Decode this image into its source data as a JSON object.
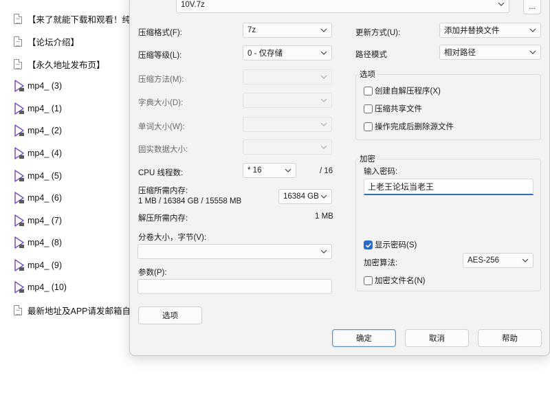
{
  "files": [
    {
      "type": "doc",
      "label": "【来了就能下载和观看！纯免"
    },
    {
      "type": "doc",
      "label": "【论坛介绍】"
    },
    {
      "type": "doc",
      "label": "【永久地址发布页】"
    },
    {
      "type": "video",
      "label": "mp4_ (3)"
    },
    {
      "type": "video",
      "label": "mp4_ (1)"
    },
    {
      "type": "video",
      "label": "mp4_ (2)"
    },
    {
      "type": "video",
      "label": "mp4_ (4)"
    },
    {
      "type": "video",
      "label": "mp4_ (5)"
    },
    {
      "type": "video",
      "label": "mp4_ (6)"
    },
    {
      "type": "video",
      "label": "mp4_ (7)"
    },
    {
      "type": "video",
      "label": "mp4_ (8)"
    },
    {
      "type": "video",
      "label": "mp4_ (9)"
    },
    {
      "type": "video",
      "label": "mp4_ (10)"
    },
    {
      "type": "doc",
      "label": "最新地址及APP请发邮箱自动"
    }
  ],
  "archive": {
    "name_value": "10V.7z",
    "browse_label": "..."
  },
  "left": {
    "format_label": "压缩格式(F):",
    "format_value": "7z",
    "level_label": "压缩等级(L):",
    "level_value": "0 - 仅存储",
    "method_label": "压缩方法(M):",
    "dict_label": "字典大小(D):",
    "word_label": "单词大小(W):",
    "solid_label": "固实数据大小:",
    "cpu_label": "CPU 线程数:",
    "cpu_value": "* 16",
    "cpu_total": "/ 16",
    "mem_label": "压缩所需内存:",
    "mem_detail": "1 MB / 16384 GB / 15558 MB",
    "mem_value": "16384 GB",
    "decomp_label": "解压所需内存:",
    "decomp_value": "1 MB",
    "split_label": "分卷大小，字节(V):",
    "split_value": "",
    "params_label": "参数(P):",
    "params_value": "",
    "options_button": "选项"
  },
  "right": {
    "update_label": "更新方式(U):",
    "update_value": "添加并替换文件",
    "path_label": "路径模式",
    "path_value": "相对路径",
    "options_title": "选项",
    "opt_sfx": "创建自解压程序(X)",
    "opt_shared": "压缩共享文件",
    "opt_delete": "操作完成后删除源文件",
    "enc_title": "加密",
    "pwd_label": "输入密码:",
    "pwd_value": "上老王论坛当老王",
    "show_pwd": "显示密码(S)",
    "enc_method_label": "加密算法:",
    "enc_method_value": "AES-256",
    "enc_names": "加密文件名(N)"
  },
  "buttons": {
    "ok": "确定",
    "cancel": "取消",
    "help": "帮助"
  },
  "colors": {
    "accent": "#2b6bc4",
    "dialog_bg": "#f3f3f3"
  }
}
